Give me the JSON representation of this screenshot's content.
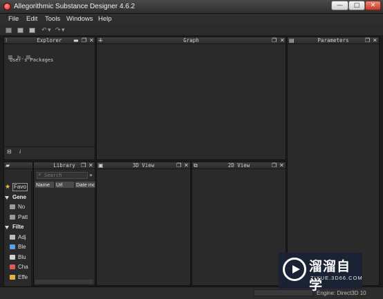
{
  "window": {
    "title": "Allegorithmic Substance Designer 4.6.2",
    "minimize_glyph": "—",
    "maximize_glyph": "□",
    "close_glyph": "✕"
  },
  "menu": {
    "items": [
      "File",
      "Edit",
      "Tools",
      "Windows",
      "Help"
    ]
  },
  "panels": {
    "explorer": {
      "title": "Explorer",
      "root": "User's Packages",
      "footer_icon": "i"
    },
    "graph": {
      "title": "Graph"
    },
    "parameters": {
      "title": "Parameters"
    },
    "library": {
      "title": "Library",
      "search_placeholder": "Search",
      "columns": [
        "Name",
        "Url",
        "Date mo"
      ]
    },
    "view3d": {
      "title": "3D View"
    },
    "view2d": {
      "title": "2D View"
    }
  },
  "library_tree": [
    {
      "label": "Favo",
      "kind": "fav",
      "icon": "star-icon",
      "color": "#f2c33a"
    },
    {
      "label": "Gene",
      "kind": "cat",
      "icon": "triangle-down-icon",
      "color": "#dcdcdc"
    },
    {
      "label": "No",
      "kind": "item",
      "icon": "node-icon",
      "color": "#9a9a9a"
    },
    {
      "label": "Patt",
      "kind": "item",
      "icon": "pattern-icon",
      "color": "#9a9a9a"
    },
    {
      "label": "Filte",
      "kind": "cat",
      "icon": "triangle-down-icon",
      "color": "#dcdcdc"
    },
    {
      "label": "Adj",
      "kind": "item",
      "icon": "adjust-icon",
      "color": "#bdbdbd"
    },
    {
      "label": "Ble",
      "kind": "item",
      "icon": "blend-icon",
      "color": "#5aa0e6"
    },
    {
      "label": "Blu",
      "kind": "item",
      "icon": "blur-icon",
      "color": "#d0d0d0"
    },
    {
      "label": "Cha",
      "kind": "item",
      "icon": "channels-icon",
      "color": "#e05a5a"
    },
    {
      "label": "Effe",
      "kind": "item",
      "icon": "effects-icon",
      "color": "#e6b33a"
    }
  ],
  "status": {
    "right_text": "Engine: Direct3D 10"
  },
  "watermark": {
    "title": "溜溜自学",
    "url": "ZIXUE.3D66.COM"
  },
  "colors": {
    "background": "#1c1c1c",
    "panel": "#2a2a2a",
    "watermark_bg": "#182234",
    "close_button": "#c43b2b"
  }
}
